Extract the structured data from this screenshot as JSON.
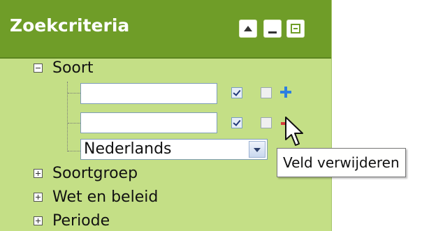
{
  "panel": {
    "title": "Zoekcriteria",
    "controls": [
      {
        "name": "collapse-up-icon"
      },
      {
        "name": "minimize-icon"
      },
      {
        "name": "maximize-icon"
      }
    ]
  },
  "tree": {
    "items": [
      {
        "label": "Soort",
        "expanded": true
      },
      {
        "label": "Soortgroep",
        "expanded": false
      },
      {
        "label": "Wet en beleid",
        "expanded": false
      },
      {
        "label": "Periode",
        "expanded": false
      }
    ],
    "soort": {
      "fields": [
        {
          "value": "",
          "checkbox1": true,
          "checkbox2": false,
          "action": "add"
        },
        {
          "value": "",
          "checkbox1": true,
          "checkbox2": false,
          "action": "remove"
        }
      ],
      "language_select": {
        "selected": "Nederlands"
      }
    }
  },
  "tooltip": {
    "text": "Veld verwijderen"
  },
  "colors": {
    "header_green": "#6f9d28",
    "panel_green": "#c4df86",
    "add_blue": "#2d7fe0",
    "remove_red": "#d63a3a"
  }
}
